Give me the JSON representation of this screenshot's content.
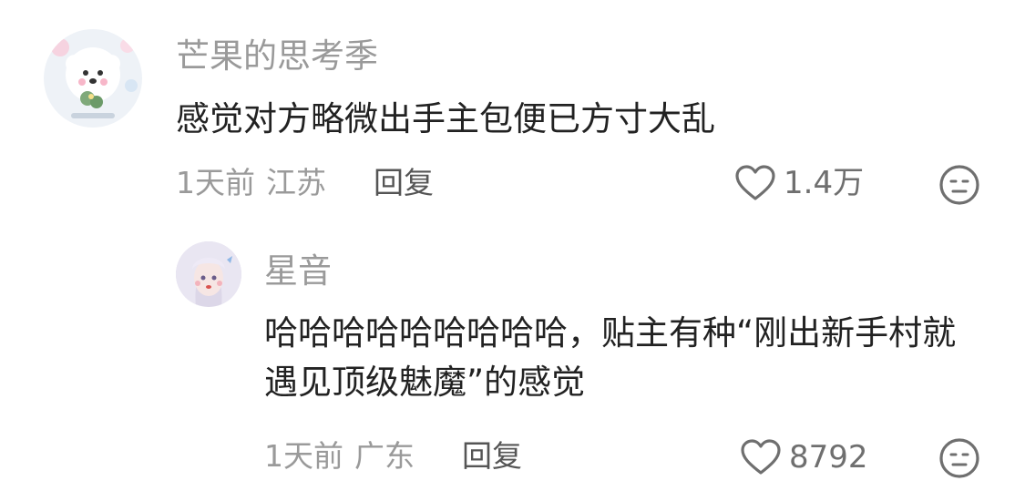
{
  "comments": [
    {
      "username": "芒果的思考季",
      "text": "感觉对方略微出手主包便已方寸大乱",
      "time": "1天前",
      "location": "江苏",
      "reply_label": "回复",
      "likes": "1.4万",
      "avatar_icon": "fluffy-white-dog-avatar",
      "like_icon": "heart-outline-icon",
      "dislike_icon": "neutral-face-icon",
      "replies": [
        {
          "username": "星音",
          "text": "哈哈哈哈哈哈哈哈哈，贴主有种“刚出新手村就遇见顶级魅魔”的感觉",
          "time": "1天前",
          "location": "广东",
          "reply_label": "回复",
          "likes": "8792",
          "avatar_icon": "anime-girl-avatar",
          "like_icon": "heart-outline-icon",
          "dislike_icon": "neutral-face-icon"
        }
      ]
    }
  ],
  "colors": {
    "username": "#9a9a9a",
    "content": "#222222",
    "meta": "#9a9a9a",
    "reply": "#555555",
    "icon": "#6f6f6f"
  }
}
